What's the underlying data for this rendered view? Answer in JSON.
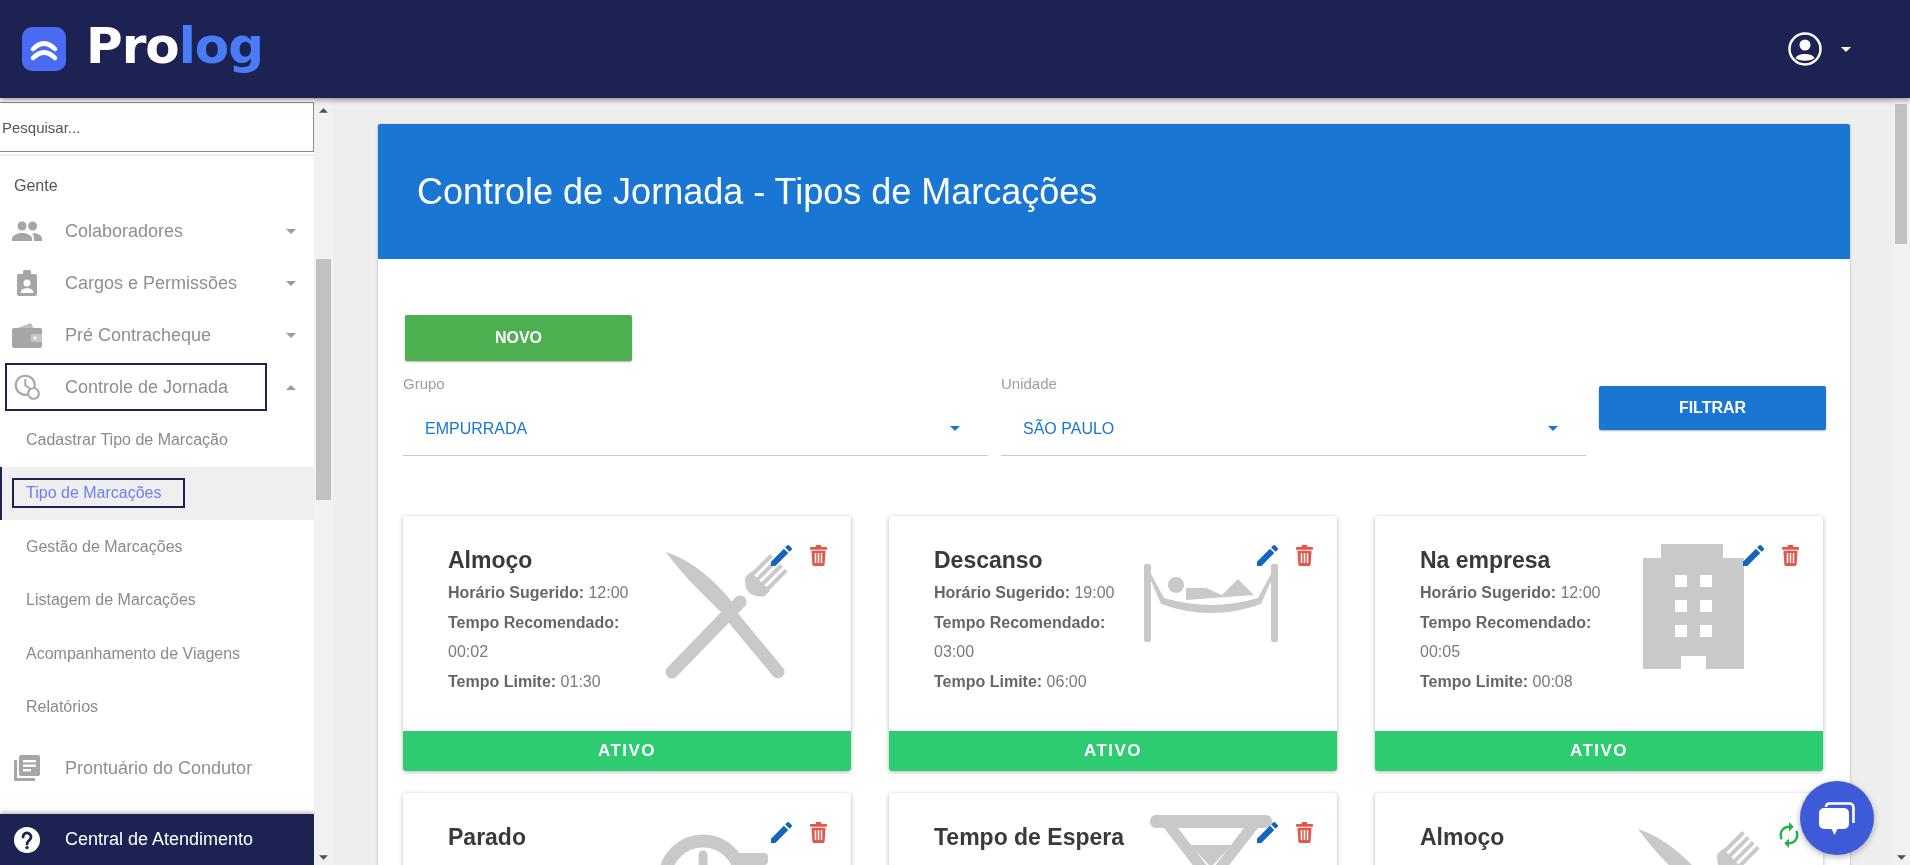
{
  "header": {
    "brand": {
      "name_start": "Pro",
      "name_end": "log"
    }
  },
  "sidebar": {
    "search": {
      "placeholder": "Pesquisar..."
    },
    "section": "Gente",
    "items": [
      {
        "kind": "group",
        "label": "Colaboradores",
        "expanded": false,
        "outlined": false
      },
      {
        "kind": "group",
        "label": "Cargos e Permissões",
        "expanded": false,
        "outlined": false
      },
      {
        "kind": "group",
        "label": "Pré Contracheque",
        "expanded": false,
        "outlined": false
      },
      {
        "kind": "group",
        "label": "Controle de Jornada",
        "expanded": true,
        "outlined": true,
        "children": [
          {
            "label": "Cadastrar Tipo de Marcação",
            "selected": false,
            "outlined": false
          },
          {
            "label": "Tipo de Marcações",
            "selected": true,
            "outlined": true
          },
          {
            "label": "Gestão de Marcações",
            "selected": false,
            "outlined": false
          },
          {
            "label": "Listagem de Marcações",
            "selected": false,
            "outlined": false
          },
          {
            "label": "Acompanhamento de Viagens",
            "selected": false,
            "outlined": false
          },
          {
            "label": "Relatórios",
            "selected": false,
            "outlined": false
          }
        ]
      },
      {
        "kind": "link",
        "label": "Prontuário do Condutor",
        "outlined": false
      }
    ],
    "help": {
      "label": "Central de Atendimento"
    }
  },
  "page": {
    "title": "Controle de Jornada - Tipos de Marcações",
    "new_button": "NOVO",
    "filters": [
      {
        "label": "Grupo",
        "value": "EMPURRADA"
      },
      {
        "label": "Unidade",
        "value": "SÃO PAULO"
      }
    ],
    "filter_button": "FILTRAR",
    "cards": [
      {
        "title": "Almoço",
        "active": true,
        "details": [
          {
            "label": "Horário Sugerido:",
            "value": "12:00"
          },
          {
            "label": "Tempo Recomendado:",
            "value": "00:02"
          },
          {
            "label": "Tempo Limite:",
            "value": "01:30"
          }
        ],
        "status": "ATIVO"
      },
      {
        "title": "Descanso",
        "active": true,
        "details": [
          {
            "label": "Horário Sugerido:",
            "value": "19:00"
          },
          {
            "label": "Tempo Recomendado:",
            "value": "03:00"
          },
          {
            "label": "Tempo Limite:",
            "value": "06:00"
          }
        ],
        "status": "ATIVO"
      },
      {
        "title": "Na empresa",
        "active": true,
        "details": [
          {
            "label": "Horário Sugerido:",
            "value": "12:00"
          },
          {
            "label": "Tempo Recomendado:",
            "value": "00:05"
          },
          {
            "label": "Tempo Limite:",
            "value": "00:08"
          }
        ],
        "status": "ATIVO"
      },
      {
        "title": "Parado",
        "active": true
      },
      {
        "title": "Tempo de Espera",
        "active": true
      },
      {
        "title": "Almoço",
        "active": false
      }
    ]
  }
}
